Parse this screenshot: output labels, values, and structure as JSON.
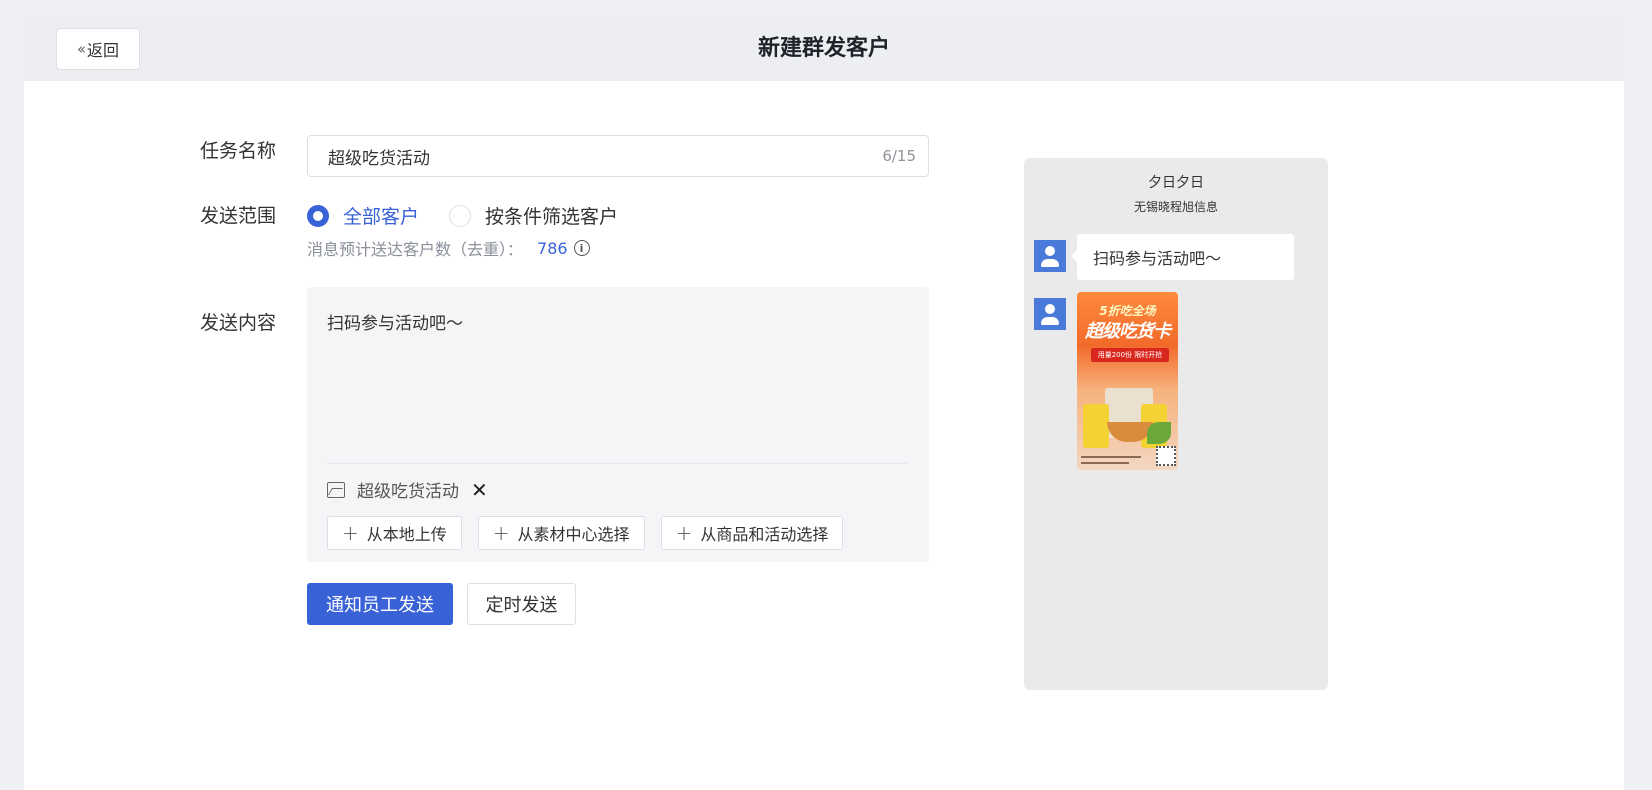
{
  "header": {
    "back_label": "返回",
    "title": "新建群发客户"
  },
  "form": {
    "task_name_label": "任务名称",
    "task_name_value": "超级吃货活动",
    "task_name_count": "6/15",
    "scope_label": "发送范围",
    "scope_options": [
      {
        "label": "全部客户",
        "selected": true
      },
      {
        "label": "按条件筛选客户",
        "selected": false
      }
    ],
    "estimate_text": "消息预计送达客户数（去重）：",
    "estimate_value": "786",
    "content_label": "发送内容",
    "content_text": "扫码参与活动吧～",
    "attachment_name": "超级吃货活动",
    "source_buttons": [
      "从本地上传",
      "从素材中心选择",
      "从商品和活动选择"
    ]
  },
  "actions": {
    "primary_label": "通知员工发送",
    "secondary_label": "定时发送"
  },
  "preview": {
    "name": "夕日夕日",
    "company": "无锡晓程旭信息",
    "message": "扫码参与活动吧～",
    "poster": {
      "line1": "5折吃全场",
      "line2": "超级吃货卡",
      "ribbon": "用量200份 限时开抢"
    }
  },
  "colors": {
    "accent": "#3a62d7",
    "topbar": "#edeef2",
    "preview_bg": "#eaeaea"
  }
}
